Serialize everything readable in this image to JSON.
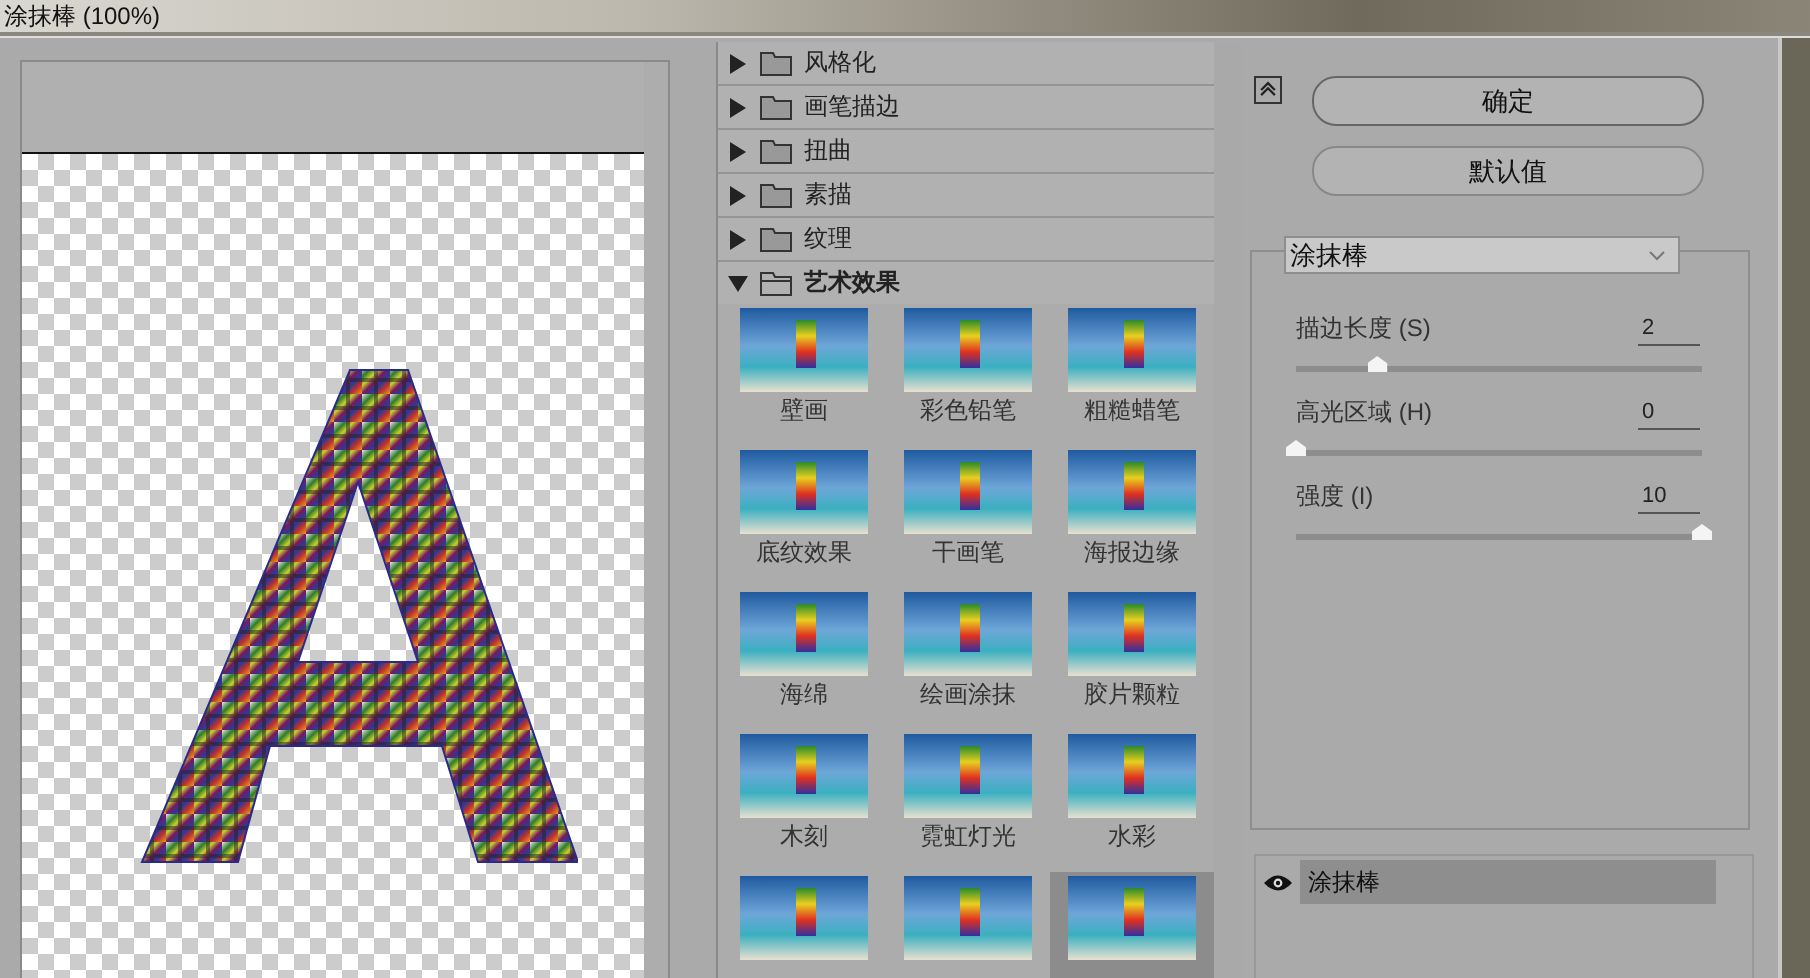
{
  "window": {
    "title": "涂抹棒 (100%)"
  },
  "categories": [
    {
      "label": "风格化",
      "expanded": false
    },
    {
      "label": "画笔描边",
      "expanded": false
    },
    {
      "label": "扭曲",
      "expanded": false
    },
    {
      "label": "素描",
      "expanded": false
    },
    {
      "label": "纹理",
      "expanded": false
    },
    {
      "label": "艺术效果",
      "expanded": true,
      "thumbnails": [
        {
          "label": "壁画",
          "selected": false
        },
        {
          "label": "彩色铅笔",
          "selected": false
        },
        {
          "label": "粗糙蜡笔",
          "selected": false
        },
        {
          "label": "底纹效果",
          "selected": false
        },
        {
          "label": "干画笔",
          "selected": false
        },
        {
          "label": "海报边缘",
          "selected": false
        },
        {
          "label": "海绵",
          "selected": false
        },
        {
          "label": "绘画涂抹",
          "selected": false
        },
        {
          "label": "胶片颗粒",
          "selected": false
        },
        {
          "label": "木刻",
          "selected": false
        },
        {
          "label": "霓虹灯光",
          "selected": false
        },
        {
          "label": "水彩",
          "selected": false
        },
        {
          "selected": false
        },
        {
          "selected": false
        },
        {
          "selected": true
        }
      ]
    }
  ],
  "buttons": [
    {
      "label": "确定"
    },
    {
      "label": "默认值"
    }
  ],
  "filter_select": {
    "value": "涂抹棒"
  },
  "sliders": [
    {
      "label": "描边长度 (S)",
      "value": "2",
      "level": 0.2
    },
    {
      "label": "高光区域 (H)",
      "value": "0",
      "level": 0
    },
    {
      "label": "强度 (I)",
      "value": "10",
      "level": 1
    }
  ],
  "layers": [
    {
      "name": "涂抹棒",
      "visible": true
    }
  ]
}
